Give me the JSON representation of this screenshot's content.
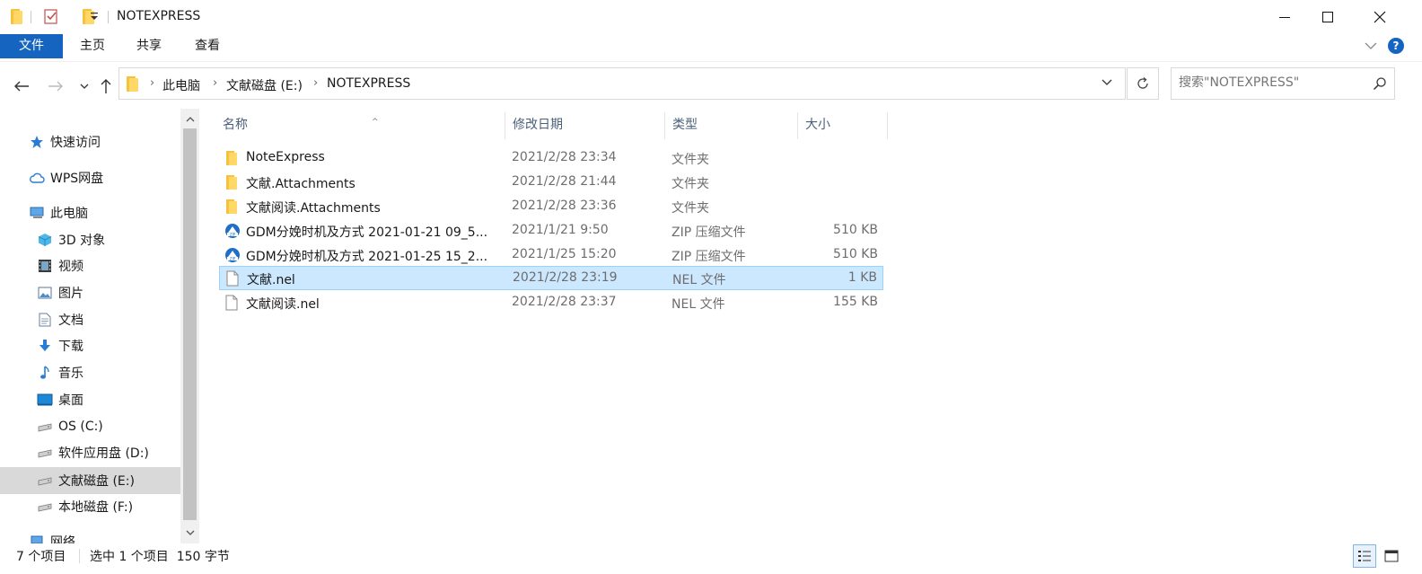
{
  "window": {
    "title": "NOTEXPRESS"
  },
  "ribbon": {
    "tabs": [
      {
        "label": "文件"
      },
      {
        "label": "主页"
      },
      {
        "label": "共享"
      },
      {
        "label": "查看"
      }
    ]
  },
  "address": {
    "breadcrumbs": [
      "此电脑",
      "文献磁盘 (E:)",
      "NOTEXPRESS"
    ]
  },
  "search": {
    "placeholder": "搜索\"NOTEXPRESS\""
  },
  "sidebar": {
    "items": [
      {
        "label": "快速访问",
        "icon": "star-icon"
      },
      {
        "label": "WPS网盘",
        "icon": "cloud-icon"
      },
      {
        "label": "此电脑",
        "icon": "computer-icon"
      },
      {
        "label": "3D 对象",
        "icon": "cube-icon"
      },
      {
        "label": "视频",
        "icon": "video-icon"
      },
      {
        "label": "图片",
        "icon": "picture-icon"
      },
      {
        "label": "文档",
        "icon": "document-icon"
      },
      {
        "label": "下载",
        "icon": "download-icon"
      },
      {
        "label": "音乐",
        "icon": "music-icon"
      },
      {
        "label": "桌面",
        "icon": "desktop-icon"
      },
      {
        "label": "OS (C:)",
        "icon": "drive-icon"
      },
      {
        "label": "软件应用盘 (D:)",
        "icon": "drive-icon"
      },
      {
        "label": "文献磁盘 (E:)",
        "icon": "drive-icon",
        "selected": true
      },
      {
        "label": "本地磁盘 (F:)",
        "icon": "drive-icon"
      },
      {
        "label": "网络",
        "icon": "network-icon"
      }
    ]
  },
  "columns": {
    "name": "名称",
    "date": "修改日期",
    "type": "类型",
    "size": "大小"
  },
  "files": [
    {
      "name": "NoteExpress",
      "date": "2021/2/28 23:34",
      "type": "文件夹",
      "size": "",
      "icon": "folder-icon"
    },
    {
      "name": "文献.Attachments",
      "date": "2021/2/28 21:44",
      "type": "文件夹",
      "size": "",
      "icon": "folder-icon"
    },
    {
      "name": "文献阅读.Attachments",
      "date": "2021/2/28 23:36",
      "type": "文件夹",
      "size": "",
      "icon": "folder-icon"
    },
    {
      "name": "GDM分娩时机及方式 2021-01-21 09_5...",
      "date": "2021/1/21 9:50",
      "type": "ZIP 压缩文件",
      "size": "510 KB",
      "icon": "zip-icon"
    },
    {
      "name": "GDM分娩时机及方式 2021-01-25 15_2...",
      "date": "2021/1/25 15:20",
      "type": "ZIP 压缩文件",
      "size": "510 KB",
      "icon": "zip-icon"
    },
    {
      "name": "文献.nel",
      "date": "2021/2/28 23:19",
      "type": "NEL 文件",
      "size": "1 KB",
      "icon": "file-icon",
      "selected": true
    },
    {
      "name": "文献阅读.nel",
      "date": "2021/2/28 23:37",
      "type": "NEL 文件",
      "size": "155 KB",
      "icon": "file-icon"
    }
  ],
  "status": {
    "count": "7 个项目",
    "selection": "选中 1 个项目  150 字节"
  },
  "colors": {
    "accent": "#1565c0",
    "selection_bg": "#cce8ff",
    "selection_border": "#99d1ff",
    "folder": "#ffd866"
  }
}
